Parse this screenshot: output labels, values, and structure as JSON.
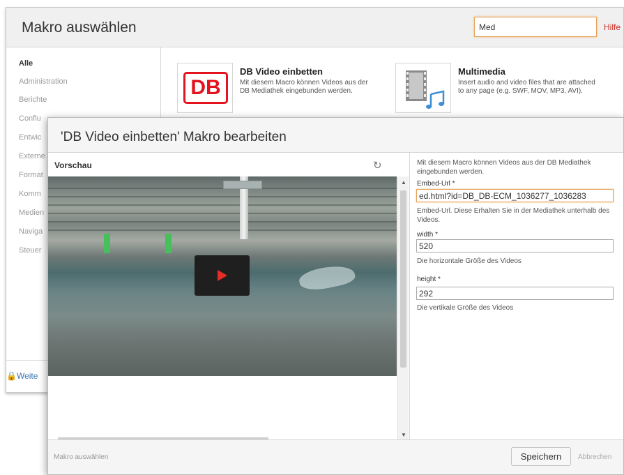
{
  "browser": {
    "title": "Makro auswählen",
    "search_value": "Med",
    "help": "Hilfe",
    "categories": [
      "Alle",
      "Administration",
      "Berichte",
      "Conflu",
      "Entwic",
      "Externe",
      "Format",
      "Komm",
      "Medien",
      "Naviga",
      "Steuer"
    ],
    "footer_link": "Weite",
    "macros": [
      {
        "name": "DB Video einbetten",
        "desc": "Mit diesem Macro können Videos aus der DB Mediathek eingebunden werden.",
        "logo": "DB"
      },
      {
        "name": "Multimedia",
        "desc": "Insert audio and video files that are attached to any page (e.g. SWF, MOV, MP3, AVI)."
      }
    ]
  },
  "editor": {
    "title": "'DB Video einbetten' Makro bearbeiten",
    "preview_label": "Vorschau",
    "intro": "Mit diesem Macro können Videos aus der DB Mediathek eingebunden werden.",
    "fields": {
      "embed_label": "Embed-Url *",
      "embed_value": "ed.html?id=DB_DB-ECM_1036277_1036283",
      "embed_help": "Embed-Url. Diese Erhalten Sie in der Mediathek unterhalb des Videos.",
      "width_label": "width *",
      "width_value": "520",
      "width_help": "Die horizontale Größe des Videos",
      "height_label": "height *",
      "height_value": "292",
      "height_help": "Die vertikale Größe des Videos"
    },
    "footer": {
      "back": "Makro auswählen",
      "save": "Speichern",
      "cancel": "Abbrechen"
    }
  },
  "colors": {
    "accent_red": "#c9312b",
    "db_red": "#e3141e",
    "focus_orange": "#e6a15a"
  }
}
